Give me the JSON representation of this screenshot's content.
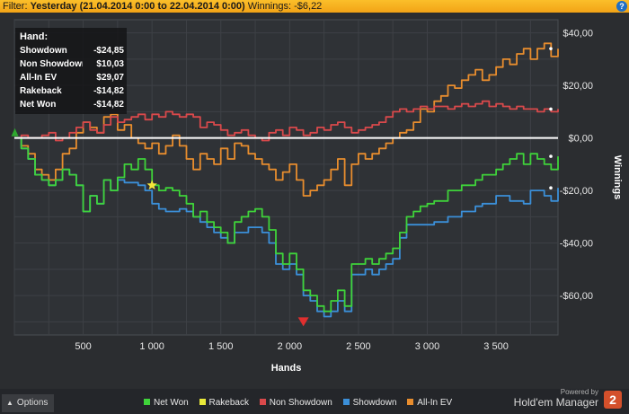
{
  "filter": {
    "label": "Filter:",
    "value": "Yesterday (21.04.2014 0:00 to 22.04.2014 0:00)",
    "winnings_label": "Winnings:",
    "winnings_value": "-$6,22"
  },
  "help_icon": "?",
  "stats": {
    "title": "Hand:",
    "rows": [
      {
        "label": "Showdown",
        "value": "-$24,85"
      },
      {
        "label": "Non Showdown",
        "value": "$10,03"
      },
      {
        "label": "All-In EV",
        "value": "$29,07"
      },
      {
        "label": "Rakeback",
        "value": "-$14,82"
      },
      {
        "label": "Net Won",
        "value": "-$14,82"
      }
    ]
  },
  "footer": {
    "options_label": "Options",
    "powered_by": "Powered by",
    "brand": "Hold'em Manager",
    "brand_logo_text": "2"
  },
  "colors": {
    "net_won": "#3fd33a",
    "rakeback": "#eaea3a",
    "non_showdown": "#d9494b",
    "showdown": "#3b8fd8",
    "allin_ev": "#e88d2e",
    "zero_line": "#ffffff"
  },
  "chart_data": {
    "type": "line",
    "title": "",
    "xlabel": "Hands",
    "ylabel": "Winnings",
    "xlim": [
      0,
      3950
    ],
    "ylim": [
      -75,
      45
    ],
    "x_ticks": [
      500,
      1000,
      1500,
      2000,
      2500,
      3000,
      3500
    ],
    "x_tick_labels": [
      "500",
      "1 000",
      "1 500",
      "2 000",
      "2 500",
      "3 000",
      "3 500"
    ],
    "y_ticks": [
      40,
      20,
      0,
      -20,
      -40,
      -60
    ],
    "y_tick_labels": [
      "$40,00",
      "$20,00",
      "$0,00",
      "-$20,00",
      "-$40,00",
      "-$60,00"
    ],
    "grid": true,
    "legend_position": "bottom",
    "series": [
      {
        "name": "Net Won",
        "color_key": "net_won",
        "x": [
          0,
          50,
          100,
          150,
          200,
          250,
          300,
          350,
          400,
          450,
          500,
          550,
          600,
          650,
          700,
          750,
          800,
          850,
          900,
          950,
          1000,
          1050,
          1100,
          1150,
          1200,
          1250,
          1300,
          1350,
          1400,
          1450,
          1500,
          1550,
          1600,
          1650,
          1700,
          1750,
          1800,
          1850,
          1900,
          1950,
          2000,
          2050,
          2100,
          2150,
          2200,
          2250,
          2300,
          2350,
          2400,
          2450,
          2500,
          2550,
          2600,
          2650,
          2700,
          2750,
          2800,
          2850,
          2900,
          2950,
          3000,
          3050,
          3100,
          3150,
          3200,
          3250,
          3300,
          3350,
          3400,
          3450,
          3500,
          3550,
          3600,
          3650,
          3700,
          3750,
          3800,
          3850,
          3900,
          3950
        ],
        "y": [
          0,
          -4,
          -8,
          -14,
          -16,
          -18,
          -16,
          -12,
          -14,
          -18,
          -28,
          -22,
          -25,
          -16,
          -20,
          -15,
          -10,
          -12,
          -8,
          -12,
          -18,
          -20,
          -19,
          -20,
          -22,
          -25,
          -30,
          -28,
          -32,
          -34,
          -36,
          -40,
          -32,
          -30,
          -28,
          -27,
          -30,
          -35,
          -44,
          -48,
          -44,
          -50,
          -58,
          -60,
          -64,
          -66,
          -62,
          -58,
          -64,
          -48,
          -48,
          -46,
          -48,
          -46,
          -44,
          -42,
          -36,
          -30,
          -28,
          -26,
          -25,
          -24,
          -24,
          -20,
          -20,
          -18,
          -18,
          -16,
          -14,
          -14,
          -12,
          -10,
          -8,
          -6,
          -10,
          -6,
          -8,
          -10,
          -12,
          -7
        ]
      },
      {
        "name": "Showdown",
        "color_key": "showdown",
        "x": [
          0,
          50,
          100,
          150,
          200,
          250,
          300,
          350,
          400,
          450,
          500,
          550,
          600,
          650,
          700,
          750,
          800,
          850,
          900,
          950,
          1000,
          1050,
          1100,
          1150,
          1200,
          1250,
          1300,
          1350,
          1400,
          1450,
          1500,
          1550,
          1600,
          1650,
          1700,
          1750,
          1800,
          1850,
          1900,
          1950,
          2000,
          2050,
          2100,
          2150,
          2200,
          2250,
          2300,
          2350,
          2400,
          2450,
          2500,
          2550,
          2600,
          2650,
          2700,
          2750,
          2800,
          2850,
          2900,
          2950,
          3000,
          3050,
          3100,
          3150,
          3200,
          3250,
          3300,
          3350,
          3400,
          3450,
          3500,
          3550,
          3600,
          3650,
          3700,
          3750,
          3800,
          3850,
          3900,
          3950
        ],
        "y": [
          0,
          -4,
          -8,
          -14,
          -16,
          -18,
          -16,
          -12,
          -14,
          -18,
          -28,
          -22,
          -25,
          -16,
          -20,
          -16,
          -17,
          -17,
          -18,
          -20,
          -25,
          -27,
          -28,
          -28,
          -27,
          -28,
          -30,
          -32,
          -34,
          -36,
          -38,
          -40,
          -36,
          -36,
          -34,
          -34,
          -36,
          -40,
          -48,
          -50,
          -48,
          -52,
          -60,
          -62,
          -66,
          -68,
          -66,
          -62,
          -66,
          -52,
          -52,
          -50,
          -52,
          -50,
          -48,
          -46,
          -38,
          -33,
          -33,
          -33,
          -33,
          -32,
          -32,
          -30,
          -30,
          -28,
          -28,
          -26,
          -25,
          -25,
          -22,
          -22,
          -24,
          -24,
          -25,
          -20,
          -20,
          -22,
          -24,
          -19
        ]
      },
      {
        "name": "Non Showdown",
        "color_key": "non_showdown",
        "x": [
          0,
          50,
          100,
          150,
          200,
          250,
          300,
          350,
          400,
          450,
          500,
          550,
          600,
          650,
          700,
          750,
          800,
          850,
          900,
          950,
          1000,
          1050,
          1100,
          1150,
          1200,
          1250,
          1300,
          1350,
          1400,
          1450,
          1500,
          1550,
          1600,
          1650,
          1700,
          1750,
          1800,
          1850,
          1900,
          1950,
          2000,
          2050,
          2100,
          2150,
          2200,
          2250,
          2300,
          2350,
          2400,
          2450,
          2500,
          2550,
          2600,
          2650,
          2700,
          2750,
          2800,
          2850,
          2900,
          2950,
          3000,
          3050,
          3100,
          3150,
          3200,
          3250,
          3300,
          3350,
          3400,
          3450,
          3500,
          3550,
          3600,
          3650,
          3700,
          3750,
          3800,
          3850,
          3900,
          3950
        ],
        "y": [
          0,
          1,
          0,
          0,
          1,
          2,
          -1,
          0,
          2,
          4,
          6,
          3,
          2,
          5,
          8,
          6,
          7,
          8,
          9,
          7,
          9,
          8,
          10,
          9,
          8,
          9,
          8,
          4,
          6,
          5,
          3,
          1,
          2,
          3,
          1,
          0,
          -1,
          2,
          3,
          1,
          4,
          3,
          1,
          2,
          4,
          3,
          5,
          6,
          4,
          2,
          3,
          4,
          5,
          6,
          8,
          10,
          11,
          10,
          11,
          12,
          11,
          12,
          12,
          11,
          12,
          13,
          12,
          13,
          14,
          12,
          13,
          12,
          11,
          12,
          11,
          11,
          10,
          11,
          10,
          11
        ]
      },
      {
        "name": "All-In EV",
        "color_key": "allin_ev",
        "x": [
          0,
          50,
          100,
          150,
          200,
          250,
          300,
          350,
          400,
          450,
          500,
          550,
          600,
          650,
          700,
          750,
          800,
          850,
          900,
          950,
          1000,
          1050,
          1100,
          1150,
          1200,
          1250,
          1300,
          1350,
          1400,
          1450,
          1500,
          1550,
          1600,
          1650,
          1700,
          1750,
          1800,
          1850,
          1900,
          1950,
          2000,
          2050,
          2100,
          2150,
          2200,
          2250,
          2300,
          2350,
          2400,
          2450,
          2500,
          2550,
          2600,
          2650,
          2700,
          2750,
          2800,
          2850,
          2900,
          2950,
          3000,
          3050,
          3100,
          3150,
          3200,
          3250,
          3300,
          3350,
          3400,
          3450,
          3500,
          3550,
          3600,
          3650,
          3700,
          3750,
          3800,
          3850,
          3900,
          3950
        ],
        "y": [
          0,
          -3,
          -6,
          -12,
          -14,
          -16,
          -12,
          -6,
          -4,
          2,
          6,
          4,
          2,
          8,
          9,
          3,
          5,
          0,
          -2,
          -4,
          -2,
          -6,
          -3,
          1,
          -3,
          -8,
          -12,
          -6,
          -8,
          -10,
          -4,
          -8,
          -2,
          -3,
          -6,
          -8,
          -10,
          -12,
          -16,
          -13,
          -10,
          -16,
          -22,
          -20,
          -18,
          -16,
          -12,
          -8,
          -18,
          -10,
          -6,
          -8,
          -6,
          -4,
          -2,
          0,
          2,
          3,
          6,
          11,
          10,
          14,
          16,
          20,
          19,
          22,
          24,
          26,
          22,
          24,
          27,
          30,
          28,
          32,
          34,
          30,
          34,
          36,
          31,
          34
        ]
      },
      {
        "name": "Rakeback",
        "color_key": "rakeback",
        "x": [
          0,
          3950
        ],
        "y": [
          0,
          0
        ]
      }
    ],
    "markers": [
      {
        "type": "star",
        "x": 1000,
        "y": -18
      },
      {
        "type": "triangle-down",
        "x": 2100,
        "y": -70
      },
      {
        "type": "triangle-up",
        "x": 10,
        "y": 2
      }
    ]
  }
}
